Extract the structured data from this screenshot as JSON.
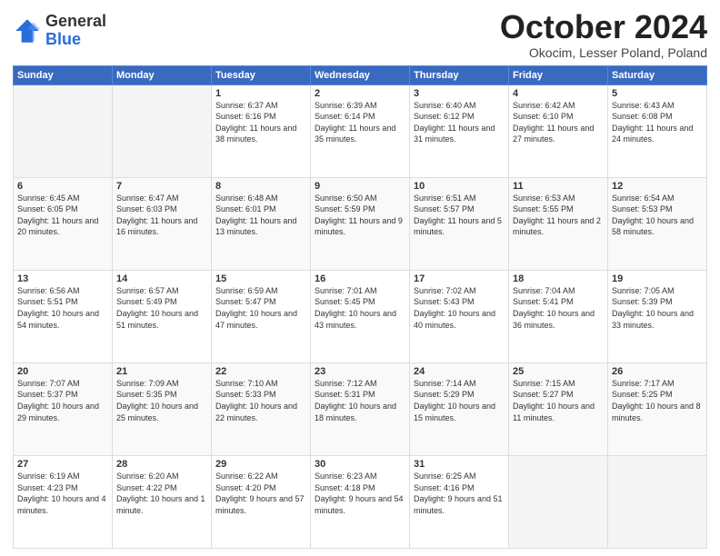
{
  "logo": {
    "general": "General",
    "blue": "Blue"
  },
  "header": {
    "month": "October 2024",
    "location": "Okocim, Lesser Poland, Poland"
  },
  "days_of_week": [
    "Sunday",
    "Monday",
    "Tuesday",
    "Wednesday",
    "Thursday",
    "Friday",
    "Saturday"
  ],
  "weeks": [
    [
      {
        "day": "",
        "info": ""
      },
      {
        "day": "",
        "info": ""
      },
      {
        "day": "1",
        "info": "Sunrise: 6:37 AM\nSunset: 6:16 PM\nDaylight: 11 hours and 38 minutes."
      },
      {
        "day": "2",
        "info": "Sunrise: 6:39 AM\nSunset: 6:14 PM\nDaylight: 11 hours and 35 minutes."
      },
      {
        "day": "3",
        "info": "Sunrise: 6:40 AM\nSunset: 6:12 PM\nDaylight: 11 hours and 31 minutes."
      },
      {
        "day": "4",
        "info": "Sunrise: 6:42 AM\nSunset: 6:10 PM\nDaylight: 11 hours and 27 minutes."
      },
      {
        "day": "5",
        "info": "Sunrise: 6:43 AM\nSunset: 6:08 PM\nDaylight: 11 hours and 24 minutes."
      }
    ],
    [
      {
        "day": "6",
        "info": "Sunrise: 6:45 AM\nSunset: 6:05 PM\nDaylight: 11 hours and 20 minutes."
      },
      {
        "day": "7",
        "info": "Sunrise: 6:47 AM\nSunset: 6:03 PM\nDaylight: 11 hours and 16 minutes."
      },
      {
        "day": "8",
        "info": "Sunrise: 6:48 AM\nSunset: 6:01 PM\nDaylight: 11 hours and 13 minutes."
      },
      {
        "day": "9",
        "info": "Sunrise: 6:50 AM\nSunset: 5:59 PM\nDaylight: 11 hours and 9 minutes."
      },
      {
        "day": "10",
        "info": "Sunrise: 6:51 AM\nSunset: 5:57 PM\nDaylight: 11 hours and 5 minutes."
      },
      {
        "day": "11",
        "info": "Sunrise: 6:53 AM\nSunset: 5:55 PM\nDaylight: 11 hours and 2 minutes."
      },
      {
        "day": "12",
        "info": "Sunrise: 6:54 AM\nSunset: 5:53 PM\nDaylight: 10 hours and 58 minutes."
      }
    ],
    [
      {
        "day": "13",
        "info": "Sunrise: 6:56 AM\nSunset: 5:51 PM\nDaylight: 10 hours and 54 minutes."
      },
      {
        "day": "14",
        "info": "Sunrise: 6:57 AM\nSunset: 5:49 PM\nDaylight: 10 hours and 51 minutes."
      },
      {
        "day": "15",
        "info": "Sunrise: 6:59 AM\nSunset: 5:47 PM\nDaylight: 10 hours and 47 minutes."
      },
      {
        "day": "16",
        "info": "Sunrise: 7:01 AM\nSunset: 5:45 PM\nDaylight: 10 hours and 43 minutes."
      },
      {
        "day": "17",
        "info": "Sunrise: 7:02 AM\nSunset: 5:43 PM\nDaylight: 10 hours and 40 minutes."
      },
      {
        "day": "18",
        "info": "Sunrise: 7:04 AM\nSunset: 5:41 PM\nDaylight: 10 hours and 36 minutes."
      },
      {
        "day": "19",
        "info": "Sunrise: 7:05 AM\nSunset: 5:39 PM\nDaylight: 10 hours and 33 minutes."
      }
    ],
    [
      {
        "day": "20",
        "info": "Sunrise: 7:07 AM\nSunset: 5:37 PM\nDaylight: 10 hours and 29 minutes."
      },
      {
        "day": "21",
        "info": "Sunrise: 7:09 AM\nSunset: 5:35 PM\nDaylight: 10 hours and 25 minutes."
      },
      {
        "day": "22",
        "info": "Sunrise: 7:10 AM\nSunset: 5:33 PM\nDaylight: 10 hours and 22 minutes."
      },
      {
        "day": "23",
        "info": "Sunrise: 7:12 AM\nSunset: 5:31 PM\nDaylight: 10 hours and 18 minutes."
      },
      {
        "day": "24",
        "info": "Sunrise: 7:14 AM\nSunset: 5:29 PM\nDaylight: 10 hours and 15 minutes."
      },
      {
        "day": "25",
        "info": "Sunrise: 7:15 AM\nSunset: 5:27 PM\nDaylight: 10 hours and 11 minutes."
      },
      {
        "day": "26",
        "info": "Sunrise: 7:17 AM\nSunset: 5:25 PM\nDaylight: 10 hours and 8 minutes."
      }
    ],
    [
      {
        "day": "27",
        "info": "Sunrise: 6:19 AM\nSunset: 4:23 PM\nDaylight: 10 hours and 4 minutes."
      },
      {
        "day": "28",
        "info": "Sunrise: 6:20 AM\nSunset: 4:22 PM\nDaylight: 10 hours and 1 minute."
      },
      {
        "day": "29",
        "info": "Sunrise: 6:22 AM\nSunset: 4:20 PM\nDaylight: 9 hours and 57 minutes."
      },
      {
        "day": "30",
        "info": "Sunrise: 6:23 AM\nSunset: 4:18 PM\nDaylight: 9 hours and 54 minutes."
      },
      {
        "day": "31",
        "info": "Sunrise: 6:25 AM\nSunset: 4:16 PM\nDaylight: 9 hours and 51 minutes."
      },
      {
        "day": "",
        "info": ""
      },
      {
        "day": "",
        "info": ""
      }
    ]
  ]
}
